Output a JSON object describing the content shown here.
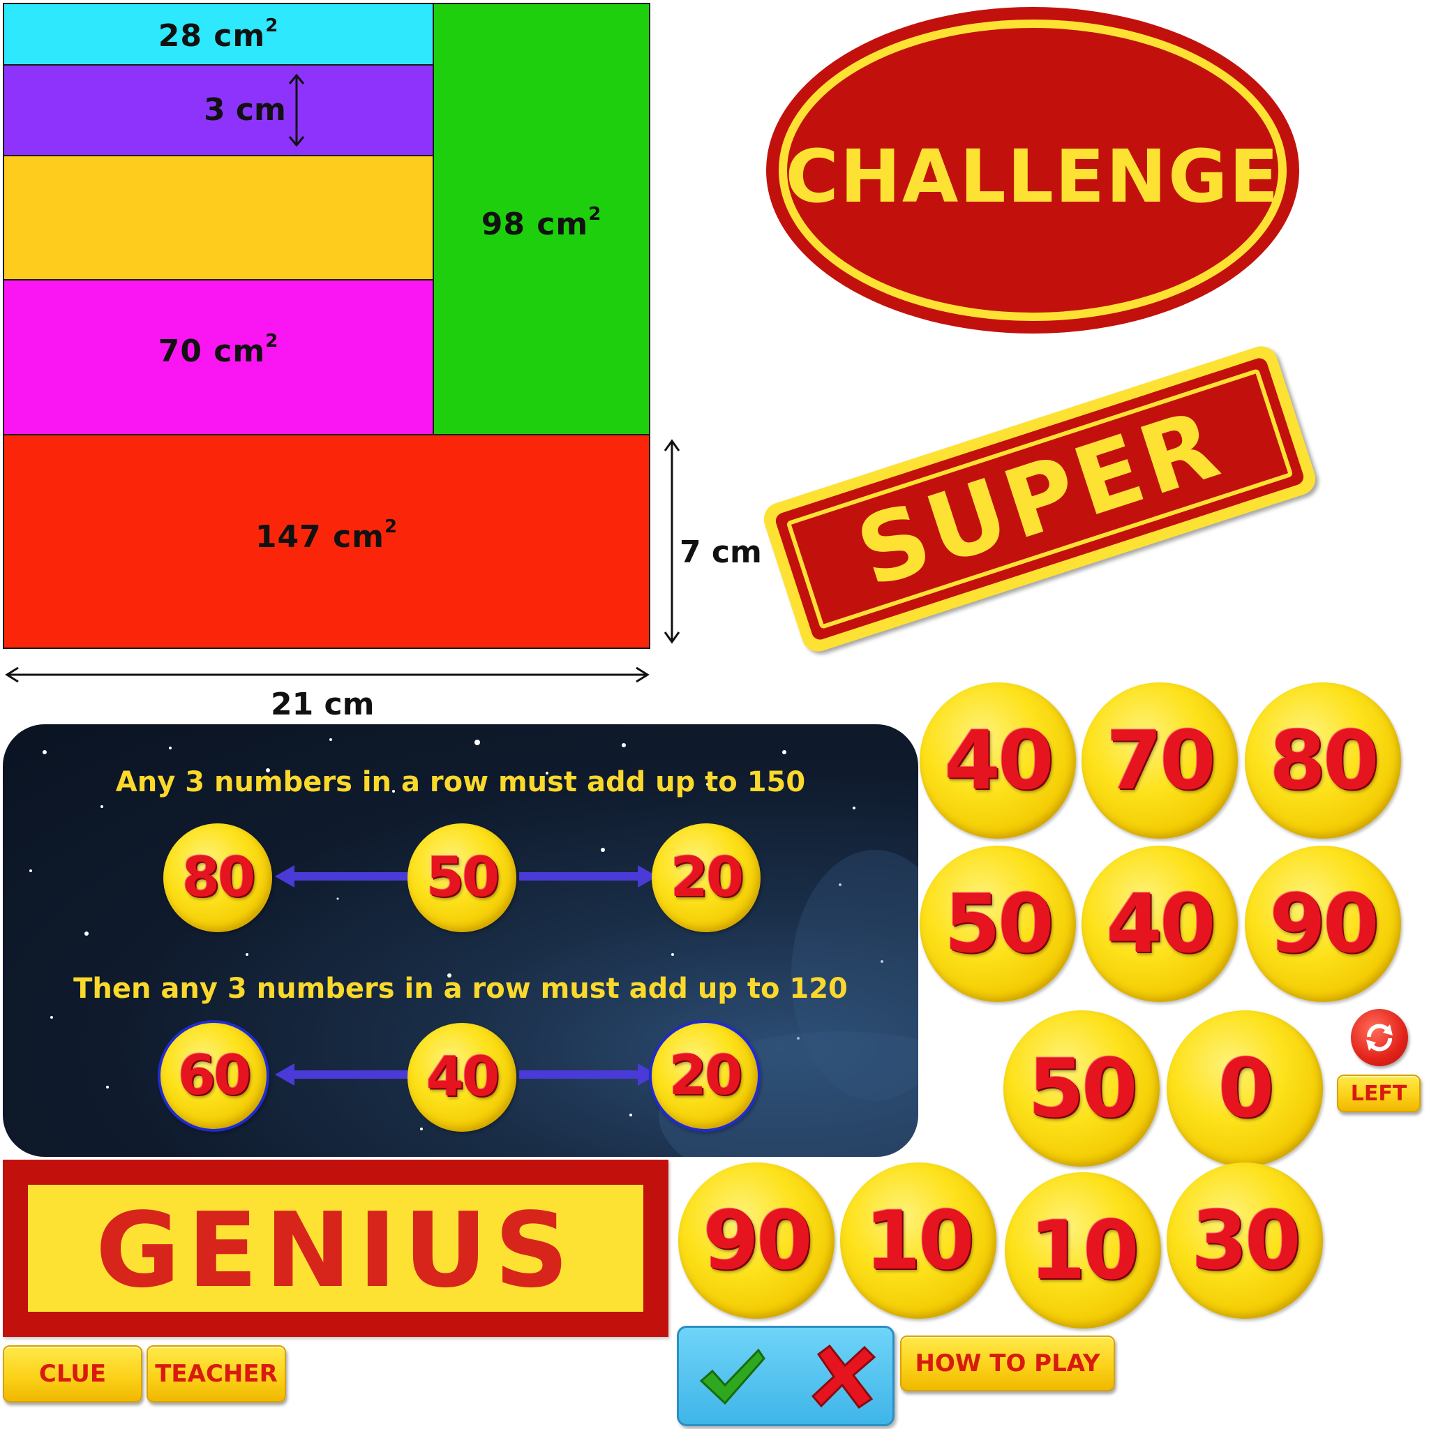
{
  "area_diagram": {
    "cyan_area": "28 cm",
    "purple_height": "3 cm",
    "green_area": "98 cm",
    "magenta_area": "70 cm",
    "red_area": "147 cm",
    "red_height": "7 cm",
    "total_width": "21 cm",
    "superscript": "2",
    "colors": {
      "cyan": "#2ee8fd",
      "purple": "#8d33fb",
      "yellow": "#fdcc1d",
      "magenta": "#f916f2",
      "green": "#1ecf0d",
      "red": "#fb260a"
    }
  },
  "stamps": {
    "challenge": "CHALLENGE",
    "super": "SUPER",
    "genius": "GENIUS",
    "stamp_red": "#c2110d",
    "stamp_yellow": "#fde234"
  },
  "puzzle_panel": {
    "rule_1": "Any 3 numbers in a row must add up to 150",
    "row_1": [
      "80",
      "50",
      "20"
    ],
    "rule_2": "Then any 3 numbers in a row must add up to 120",
    "row_2": [
      "60",
      "40",
      "20"
    ]
  },
  "number_tiles": [
    "40",
    "70",
    "80",
    "50",
    "40",
    "90",
    "50",
    "0",
    "90",
    "10",
    "10",
    "30"
  ],
  "buttons": {
    "left": "LEFT",
    "clue": "CLUE",
    "teacher": "TEACHER",
    "how_to_play": "HOW TO PLAY"
  }
}
